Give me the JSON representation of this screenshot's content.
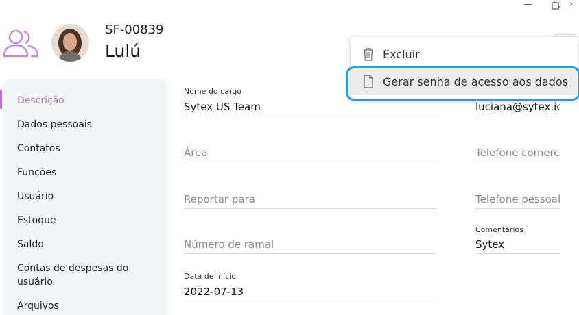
{
  "header": {
    "record_id": "SF-00839",
    "record_name": "Lulú"
  },
  "sidebar": {
    "items": [
      {
        "label": "Descrição",
        "active": true
      },
      {
        "label": "Dados pessoais"
      },
      {
        "label": "Contatos"
      },
      {
        "label": "Funções"
      },
      {
        "label": "Usuário"
      },
      {
        "label": "Estoque"
      },
      {
        "label": "Saldo"
      },
      {
        "label": "Contas de despesas do usuário"
      },
      {
        "label": "Arquivos"
      }
    ]
  },
  "form": {
    "job_title": {
      "label": "Nome do cargo",
      "value": "Sytex US Team"
    },
    "area": {
      "placeholder": "Área"
    },
    "report_to": {
      "placeholder": "Reportar para"
    },
    "extension": {
      "placeholder": "Número de ramal"
    },
    "start_date": {
      "label": "Data de início",
      "value": "2022-07-13"
    },
    "email": {
      "value": "luciana@sytex.io"
    },
    "work_phone": {
      "placeholder": "Telefone comerci"
    },
    "personal_phone": {
      "placeholder": "Telefone pessoal"
    },
    "comments": {
      "label": "Comentários",
      "value": "Sytex"
    }
  },
  "menu": {
    "items": [
      {
        "label": "Excluir",
        "icon": "trash-icon"
      },
      {
        "label": "Gerar senha de acesso aos dados",
        "icon": "document-icon",
        "highlighted": true
      }
    ]
  },
  "colors": {
    "accent": "#b56fd6",
    "highlight_ring": "#1ea0e0",
    "sidebar_bg": "#f3f6f7"
  }
}
